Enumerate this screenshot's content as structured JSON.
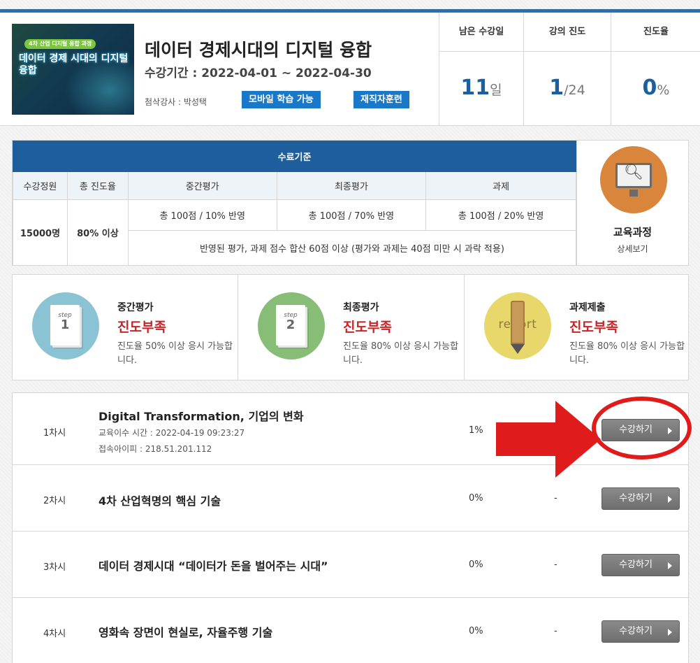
{
  "course": {
    "thumb_badge": "4차 산업 디지털 융합 과정",
    "thumb_title": "데이터 경제 시대의 디지털 융합",
    "title": "데이터 경제시대의 디지털 융합",
    "period": "수강기간 : 2022-04-01 ~ 2022-04-30",
    "instructor": "첨삭강사 : 박성택",
    "tag_mobile": "모바일 학습 가능",
    "tag_worker": "재직자훈련"
  },
  "stats": [
    {
      "label": "남은 수강일",
      "value": "11",
      "unit": "일"
    },
    {
      "label": "강의 진도",
      "value": "1",
      "unit": "/24"
    },
    {
      "label": "진도율",
      "value": "0",
      "unit": "%"
    }
  ],
  "criteria": {
    "header": "수료기준",
    "columns": [
      "수강정원",
      "총 진도율",
      "중간평가",
      "최종평가",
      "과제"
    ],
    "capacity": "15000명",
    "total_progress": "80% 이상",
    "midterm": "총 100점 / 10% 반영",
    "final": "총 100점 / 70% 반영",
    "assignment": "총 100점 / 20% 반영",
    "note": "반영된 평가, 과제 점수 합산 60점 이상 (평가와 과제는 40점 미만 시 과락 적용)"
  },
  "detail": {
    "title": "교육과정",
    "subtitle": "상세보기"
  },
  "steps": [
    {
      "doc_label": "step",
      "doc_num": "1",
      "title": "중간평가",
      "status": "진도부족",
      "desc": "진도율 50% 이상 응시 가능합니다."
    },
    {
      "doc_label": "step",
      "doc_num": "2",
      "title": "최종평가",
      "status": "진도부족",
      "desc": "진도율 80% 이상 응시 가능합니다."
    },
    {
      "icon_text": "report",
      "title": "과제제출",
      "status": "진도부족",
      "desc": "진도율 80% 이상 응시 가능합니다."
    }
  ],
  "lessons": [
    {
      "no": "1차시",
      "title": "Digital Transformation, 기업의 변화",
      "time": "교육이수 시간 : 2022-04-19 09:23:27",
      "ip": "접속아이피 : 218.51.201.112",
      "progress": "1%",
      "button": "수강하기"
    },
    {
      "no": "2차시",
      "title": "4차 산업혁명의 핵심 기술",
      "progress": "0%",
      "dash": "-",
      "button": "수강하기"
    },
    {
      "no": "3차시",
      "title": "데이터 경제시대 “데이터가 돈을 벌어주는 시대”",
      "progress": "0%",
      "dash": "-",
      "button": "수강하기"
    },
    {
      "no": "4차시",
      "title": "영화속 장면이 현실로, 자율주행 기술",
      "progress": "0%",
      "dash": "-",
      "button": "수강하기"
    }
  ],
  "colors": {
    "accent": "#1d74bb",
    "status_red": "#c82326",
    "annotation": "#e01b1b"
  }
}
